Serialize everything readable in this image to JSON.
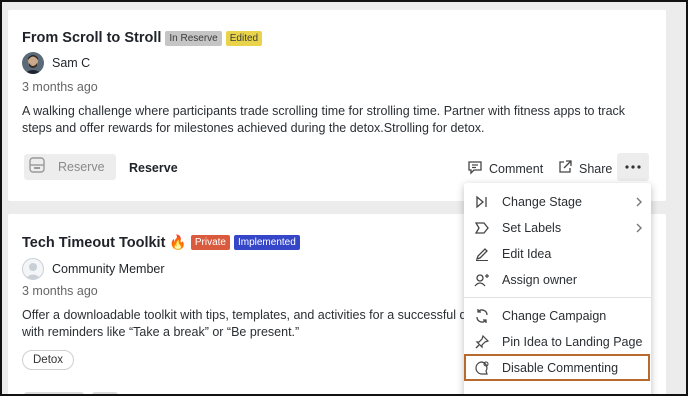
{
  "ideas": [
    {
      "title": "From Scroll to Stroll",
      "badges": [
        "In Reserve",
        "Edited"
      ],
      "author": "Sam C",
      "time": "3 months ago",
      "description": "A walking challenge where participants trade scrolling time for strolling time. Partner with fitness apps to track steps and offer rewards for milestones achieved during the detox.Strolling for detox.",
      "reserve_button": "Reserve",
      "reserve_label": "Reserve",
      "comment_label": "Comment",
      "share_label": "Share"
    },
    {
      "title": "Tech Timeout Toolkit",
      "emoji": "🔥",
      "badges": [
        "Private",
        "Implemented"
      ],
      "author": "Community Member",
      "time": "3 months ago",
      "description_line1": "Offer a downloadable toolkit with tips, templates, and activities for a successful digital",
      "description_line2": "with reminders like “Take a break” or “Be present.”",
      "tag": "Detox"
    }
  ],
  "menu": {
    "items": [
      {
        "label": "Change Stage",
        "icon": "change-stage-icon",
        "submenu": true
      },
      {
        "label": "Set Labels",
        "icon": "label-icon",
        "submenu": true
      },
      {
        "label": "Edit Idea",
        "icon": "pencil-icon",
        "submenu": false
      },
      {
        "label": "Assign owner",
        "icon": "add-user-icon",
        "submenu": false
      },
      {
        "label": "Change Campaign",
        "icon": "refresh-icon",
        "submenu": false
      },
      {
        "label": "Pin Idea to Landing Page",
        "icon": "pin-icon",
        "submenu": false
      },
      {
        "label": "Disable Commenting",
        "icon": "comment-off-icon",
        "submenu": false,
        "highlighted": true
      }
    ]
  },
  "colors": {
    "highlight_border": "#b86a2e",
    "badge_private": "#d95a3c",
    "badge_implemented": "#3546c9",
    "badge_edited": "#e8d34a",
    "badge_reserve": "#c5c5c5"
  }
}
